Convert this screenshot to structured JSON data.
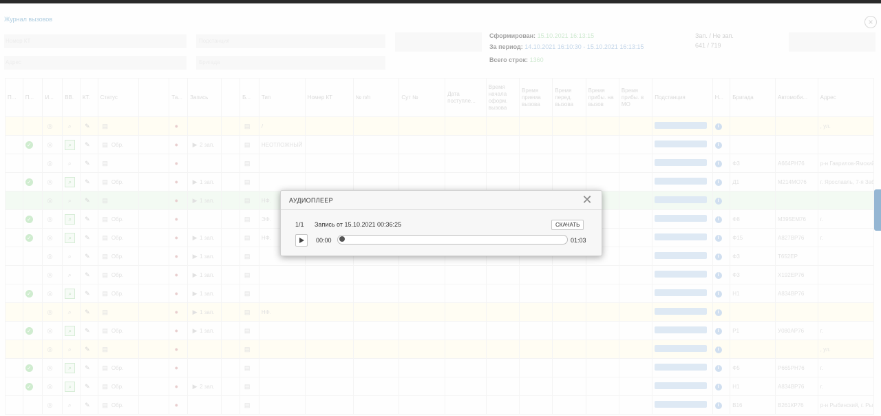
{
  "journal": {
    "title": "Журнал вызовов",
    "formed_label": "Сформирован:",
    "formed_value": "15.10.2021 16:13:15",
    "period_label": "За период:",
    "period_value": "14.10.2021 16:10:30 - 15.10.2021 16:13:15",
    "total_label": "Всего строк:",
    "total_value": "1360",
    "stats_label": "Зап. / Не зап.",
    "stats_value": "641 / 719",
    "filter1_label": "Номер КТ",
    "filter2_label": "Адрес",
    "filter3_label": "Подстанция",
    "filter4_label": "Бригада"
  },
  "table": {
    "headers": [
      "П...",
      "П...",
      "И...",
      "ВВ.",
      "КТ.",
      "Статус",
      "",
      "Та...",
      "Запись",
      "",
      "Б...",
      "Тип",
      "Номер КТ",
      "№ п/п",
      "Сут №",
      "Дата поступле...",
      "Время начала оформ. вызова",
      "Время приема вызова",
      "Время перед. вызова",
      "Время прибы. на вызов",
      "Время прибы. в МО",
      "Подстанция",
      "Н...",
      "Бригада",
      "Автомоби...",
      "Адрес"
    ],
    "rows": [
      {
        "tone": "yellow",
        "ok": false,
        "search": true,
        "status": "",
        "rec": "",
        "type": "/",
        "brigade": "",
        "car": "",
        "addr": ", ул."
      },
      {
        "tone": "",
        "ok": true,
        "search": false,
        "status": "Обр.",
        "rec": "2 зап.",
        "type": "НЕОТЛОЖНЫЙ",
        "brigade": "",
        "car": "",
        "addr": ""
      },
      {
        "tone": "",
        "ok": false,
        "search": true,
        "status": "",
        "rec": "",
        "type": "",
        "brigade": "Ф3",
        "car": "А664РН76",
        "addr": "р-н Гаврилов-Ямский, "
      },
      {
        "tone": "",
        "ok": true,
        "search": false,
        "status": "Обр.",
        "rec": "1 зап.",
        "type": "",
        "brigade": "Д1",
        "car": "М214МО76",
        "addr": "г. Ярославль, 7-я Забе"
      },
      {
        "tone": "green",
        "ok": false,
        "search": true,
        "status": "",
        "rec": "1 зап.",
        "type": "НФ.",
        "brigade": "",
        "car": "",
        "addr": ""
      },
      {
        "tone": "",
        "ok": true,
        "search": false,
        "status": "Обр.",
        "rec": "",
        "type": "ЭФ.",
        "brigade": "Ф8",
        "car": "М395ЕМ76",
        "addr": "г."
      },
      {
        "tone": "",
        "ok": true,
        "search": false,
        "status": "Обр.",
        "rec": "1 зап.",
        "type": "НФ.",
        "brigade": "Ф15",
        "car": "А827ВР76",
        "addr": "г."
      },
      {
        "tone": "",
        "ok": false,
        "search": true,
        "status": "Обр.",
        "rec": "1 зап.",
        "type": "",
        "brigade": "Ф3",
        "car": "Т652ЕР",
        "addr": ""
      },
      {
        "tone": "",
        "ok": false,
        "search": true,
        "status": "Обр.",
        "rec": "1 зап.",
        "type": "",
        "brigade": "Ф3",
        "car": "Х192ЕР76",
        "addr": ""
      },
      {
        "tone": "",
        "ok": true,
        "search": false,
        "status": "Обр.",
        "rec": "1 зап.",
        "type": "",
        "brigade": "Н1",
        "car": "А834ВР76",
        "addr": ""
      },
      {
        "tone": "yellow",
        "ok": false,
        "search": true,
        "status": "",
        "rec": "1 зап.",
        "type": "НФ.",
        "brigade": "",
        "car": "",
        "addr": ""
      },
      {
        "tone": "",
        "ok": true,
        "search": false,
        "status": "Обр.",
        "rec": "1 зап.",
        "type": "",
        "brigade": "Р1",
        "car": "У080АР76",
        "addr": "г."
      },
      {
        "tone": "yellow",
        "ok": false,
        "search": true,
        "status": "",
        "rec": "",
        "type": "",
        "brigade": "",
        "car": "",
        "addr": ", ул."
      },
      {
        "tone": "",
        "ok": true,
        "search": false,
        "status": "Обр.",
        "rec": "",
        "type": "",
        "brigade": "Ф5",
        "car": "Р665РН76",
        "addr": "г."
      },
      {
        "tone": "",
        "ok": true,
        "search": false,
        "status": "Обр.",
        "rec": "2 зап.",
        "type": "",
        "brigade": "Н1",
        "car": "А834ВР76",
        "addr": "г."
      },
      {
        "tone": "",
        "ok": false,
        "search": true,
        "status": "Обр.",
        "rec": "",
        "type": "",
        "brigade": "В16",
        "car": "В261КР76",
        "addr": "р-н Рыбинский, г. Рыб"
      }
    ]
  },
  "player": {
    "title": "АУДИОПЛЕЕР",
    "close_glyph": "✕",
    "counter": "1/1",
    "record_label": "Запись от 15.10.2021 00:36:25",
    "download_label": "СКАЧАТЬ",
    "current_time": "00:00",
    "duration": "01:03",
    "progress": 0
  },
  "icons": [
    "play-icon",
    "close-icon",
    "check-icon",
    "info-icon",
    "search-icon",
    "pencil-icon",
    "chat-icon",
    "record-icon"
  ],
  "colors": {
    "accent": "#3e7bb0",
    "ok": "#a8dca8",
    "row_yellow": "#fffbea",
    "row_green": "#eaf6ea"
  }
}
